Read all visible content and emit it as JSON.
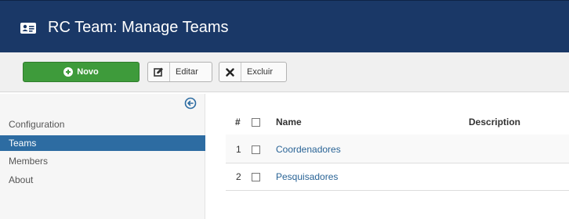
{
  "header": {
    "title": "RC Team: Manage Teams",
    "icon": "address-card-icon",
    "background_color": "#1a3867"
  },
  "toolbar": {
    "new_label": "Novo",
    "edit_label": "Editar",
    "delete_label": "Excluir",
    "new_color": "#3e9b3b"
  },
  "sidebar": {
    "items": [
      {
        "label": "Configuration",
        "active": false
      },
      {
        "label": "Teams",
        "active": true
      },
      {
        "label": "Members",
        "active": false
      },
      {
        "label": "About",
        "active": false
      }
    ],
    "active_color": "#2d6ca2"
  },
  "table": {
    "columns": [
      "#",
      "Name",
      "Description"
    ],
    "rows": [
      {
        "num": "1",
        "name": "Coordenadores",
        "description": ""
      },
      {
        "num": "2",
        "name": "Pesquisadores",
        "description": ""
      }
    ]
  }
}
